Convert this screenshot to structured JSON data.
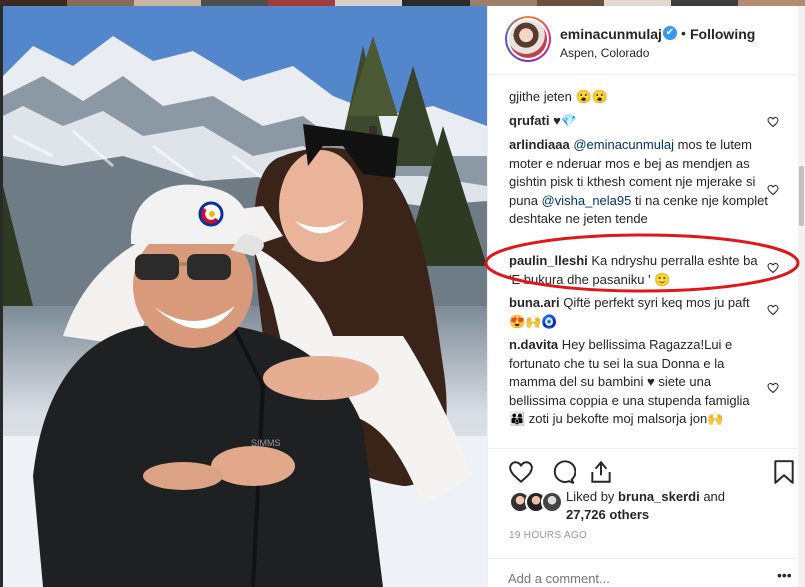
{
  "post": {
    "username": "eminacunmulaj",
    "verified_mark": "✔",
    "dot": "•",
    "follow_status": "Following",
    "location": "Aspen, Colorado"
  },
  "comments": [
    {
      "user": "",
      "text": "gjithe jeten 😮😮"
    },
    {
      "user": "qrufati",
      "text": "♥💎"
    },
    {
      "user": "arlindiaaa",
      "mention": "@eminacunmulaj",
      "text": " mos te lutem moter e nderuar mos e bej as mendjen as gishtin pisk ti kthesh coment nje mjerake si puna ",
      "mention2": "@visha_nela95",
      "text2": " ti na cenke nje komplet deshtake ne jeten tende"
    },
    {
      "user": "paulin_lleshi",
      "text": "Ka ndryshu perralla eshte ba 'E bukura dhe pasaniku ' 🙂"
    },
    {
      "user": "buna.ari",
      "text": "Qiftë perfekt syri keq mos ju paft 😍🙌🧿"
    },
    {
      "user": "n.davita",
      "text": "Hey bellissima Ragazza!Lui e fortunato che tu sei la sua Donna e la mamma del su bambini ♥ siete una bellissima coppia e una stupenda famiglia 👨‍👩‍👦 zoti ju bekofte moj malsorja jon🙌"
    }
  ],
  "likes": {
    "prefix": "Liked by ",
    "user": "bruna_skerdi",
    "and": " and",
    "count": "27,726 others"
  },
  "timestamp": "19 HOURS AGO",
  "add_comment": {
    "placeholder": "Add a comment..."
  },
  "icons": {
    "heart": "heart-icon",
    "comment": "comment-icon",
    "share": "share-icon",
    "bookmark": "bookmark-icon",
    "more": "more-options-icon"
  },
  "more_glyph": "•••",
  "colors": {
    "accent": "#3897f0",
    "text": "#262626",
    "muted": "#999999",
    "mention": "#003569",
    "annotation": "#e0161b"
  }
}
